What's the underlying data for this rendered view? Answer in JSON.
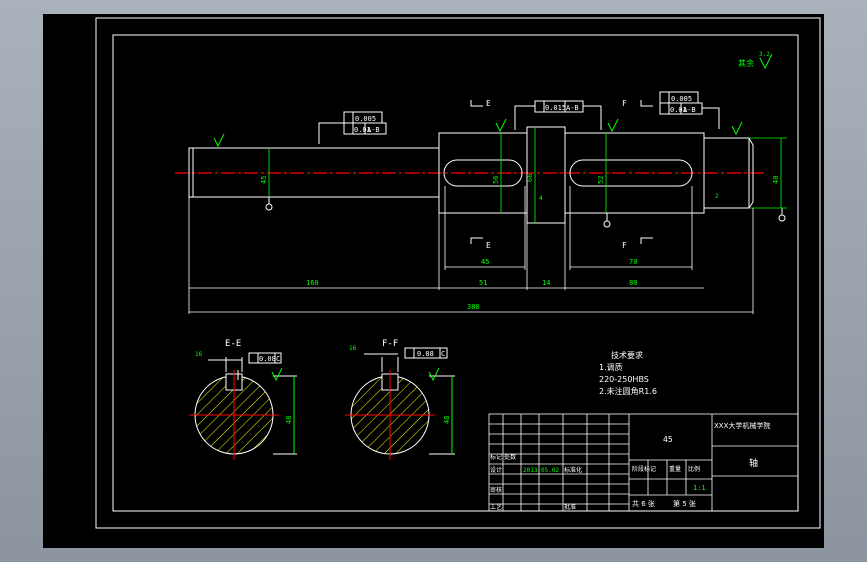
{
  "colors": {
    "background": "#000000",
    "line": "#ffffff",
    "dimension": "#00ff00",
    "center": "#ff0000",
    "hatch": "#ffff00",
    "tolerance_text": "#ffffff"
  },
  "roughness": {
    "general": "其余",
    "values": [
      "1.6",
      "3.2"
    ]
  },
  "tolerances": {
    "left_cyl": "0.005",
    "left_runout": "0.01",
    "left_datum": "A-B",
    "mid_runout": "0.015",
    "mid_datum": "A-B",
    "right_cyl": "0.005",
    "right_runout": "0.01",
    "right_datum": "A-B",
    "sym_e": "0.08",
    "sym_e_datum": "C",
    "sym_f": "0.08",
    "sym_f_datum": "C"
  },
  "datums": {
    "a": "A",
    "b": "B"
  },
  "sections": {
    "e_label": "E",
    "f_label": "F",
    "e_title": "E-E",
    "f_title": "F-F",
    "e_key": "16",
    "f_key": "16",
    "e_diam": "48",
    "f_diam": "48"
  },
  "dimensions": {
    "d_left": "45",
    "d_mid": "56",
    "d_collar": "66",
    "d_right_key": "52",
    "d_end": "40",
    "len_left": "160",
    "len_mid": "51",
    "len_collar": "14",
    "len_right": "80",
    "len_total": "380",
    "key_e": "45",
    "key_f": "70",
    "chamfer": "2",
    "shoulder": "4"
  },
  "notes": {
    "title": "技术要求",
    "line1": "1.调质",
    "line2": "220-250HBS",
    "line3": "2.未注圆角R1.6"
  },
  "title_block": {
    "material": "45",
    "company": "XXX大学机械学院",
    "part_name": "轴",
    "label_mark": "标记",
    "label_count": "处数",
    "label_design": "设计",
    "label_date": "2013.05.02",
    "label_standard": "标准化",
    "label_stage": "阶段标记",
    "label_weight": "重量",
    "label_scale": "比例",
    "scale_value": "1:1",
    "label_review": "审核",
    "label_process": "工艺",
    "label_approve": "批准",
    "sheets_total": "共 6 张",
    "sheet_no": "第 5 张"
  }
}
